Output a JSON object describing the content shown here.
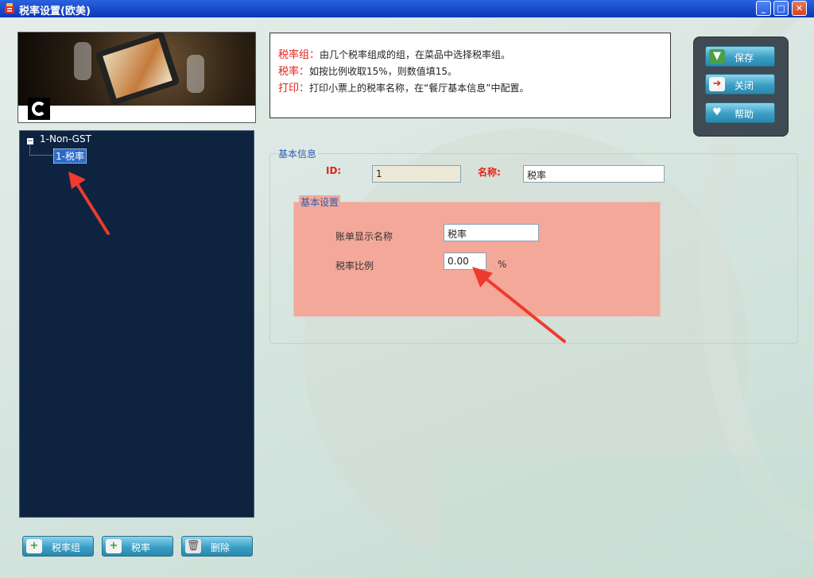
{
  "window": {
    "title": "税率设置(欧美)",
    "controls": {
      "minimize": "_",
      "maximize": "□",
      "close": "✕"
    }
  },
  "info": {
    "lines": [
      {
        "key": "税率组：",
        "text": "由几个税率组成的组，在菜品中选择税率组。"
      },
      {
        "key": "税率：",
        "text": "如按比例收取15%，则数值填15。"
      },
      {
        "key": "打印：",
        "text": "打印小票上的税率名称，在“餐厅基本信息”中配置。"
      }
    ]
  },
  "actions": {
    "save": "保存",
    "close": "关闭",
    "help": "帮助"
  },
  "tree": {
    "expander": "−",
    "root": "1-Non-GST",
    "child": "1-税率"
  },
  "bottom": {
    "add_group": "税率组",
    "add_rate": "税率",
    "delete": "删除"
  },
  "form": {
    "basic_legend": "基本信息",
    "id_label": "ID:",
    "id_value": "1",
    "name_label": "名称:",
    "name_value": "税率",
    "settings_legend": "基本设置",
    "display_label": "账单显示名称",
    "display_value": "税率",
    "ratio_label": "税率比例",
    "ratio_value": "0.00",
    "unit": "%"
  },
  "colors": {
    "accent_red": "#e2231a",
    "tree_bg": "#0d2340",
    "settings_bg": "#f4a89a",
    "button": "#3a9fc5"
  }
}
